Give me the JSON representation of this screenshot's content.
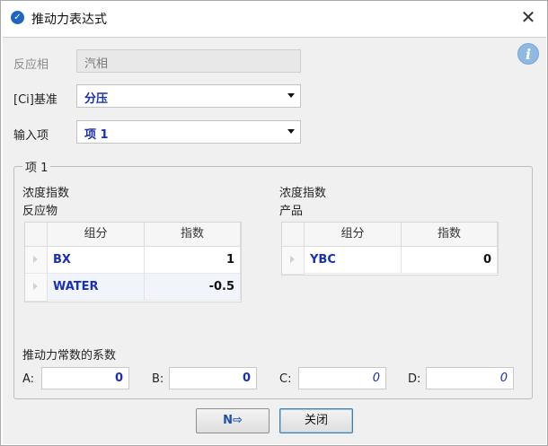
{
  "window": {
    "title": "推动力表达式",
    "close_glyph": "✕"
  },
  "form": {
    "phase_label": "反应相",
    "phase_value": "汽相",
    "basis_label": "[Ci]基准",
    "basis_value": "分压",
    "input_label": "输入项",
    "input_value": "项 1"
  },
  "group": {
    "title": "项 1",
    "left_heading_line1": "浓度指数",
    "left_heading_line2": "反应物",
    "right_heading_line1": "浓度指数",
    "right_heading_line2": "产品",
    "col_component": "组分",
    "col_exponent": "指数",
    "reactants": [
      {
        "component": "BX",
        "exponent": "1"
      },
      {
        "component": "WATER",
        "exponent": "-0.5"
      }
    ],
    "products": [
      {
        "component": "YBC",
        "exponent": "0"
      }
    ],
    "coef_title": "推动力常数的系数",
    "A_label": "A:",
    "A_value": "0",
    "B_label": "B:",
    "B_value": "0",
    "C_label": "C:",
    "C_value": "0",
    "D_label": "D:",
    "D_value": "0"
  },
  "buttons": {
    "next_glyph": "N⇨",
    "close_label": "关闭"
  },
  "colors": {
    "accent": "#1a2fb8",
    "icon_blue": "#1f66c4"
  }
}
